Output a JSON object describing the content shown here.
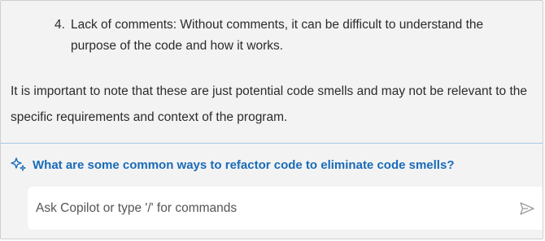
{
  "chat": {
    "response": {
      "list_item_number": "4.",
      "list_item_text": "Lack of comments: Without comments, it can be difficult to understand the purpose of the code and how it works.",
      "note": "It is important to note that these are just potential code smells and may not be relevant to the specific requirements and context of the program."
    },
    "suggestion": {
      "icon": "sparkle-icon",
      "text": "What are some common ways to refactor code to eliminate code smells?"
    },
    "input": {
      "placeholder": "Ask Copilot or type '/' for commands",
      "value": "",
      "send_icon": "send-icon"
    }
  },
  "colors": {
    "panel_background": "#f3f3f3",
    "text": "#2b2b2b",
    "accent": "#1a6bb8",
    "divider": "#a9c6e6",
    "input_background": "#ffffff"
  }
}
